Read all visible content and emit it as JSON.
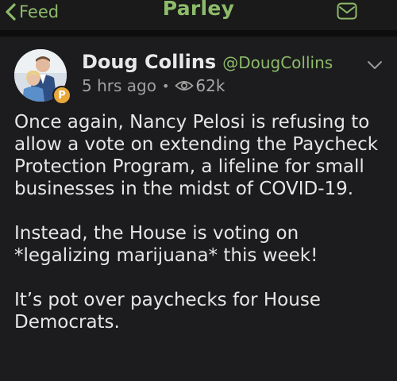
{
  "nav": {
    "back_label": "Feed",
    "title": "Parley",
    "mail_icon": "mail-icon"
  },
  "post": {
    "author": {
      "display_name": "Doug Collins",
      "handle": "@DougCollins",
      "badge": "P"
    },
    "time_ago": "5 hrs ago",
    "separator": "•",
    "views": "62k",
    "paragraphs": [
      "Once again, Nancy Pelosi is refusing to allow a vote on extending the Paycheck Protection Program, a lifeline for small businesses in the midst of COVID-19.",
      "Instead, the House is voting on *legalizing marijuana* this week!",
      "It’s pot over paychecks for House Democrats."
    ]
  },
  "colors": {
    "accent": "#8dbb6a",
    "background": "#1c1c1e",
    "text": "#e6e6e6",
    "muted": "#a0a0a0",
    "badge": "#e8a93a"
  }
}
